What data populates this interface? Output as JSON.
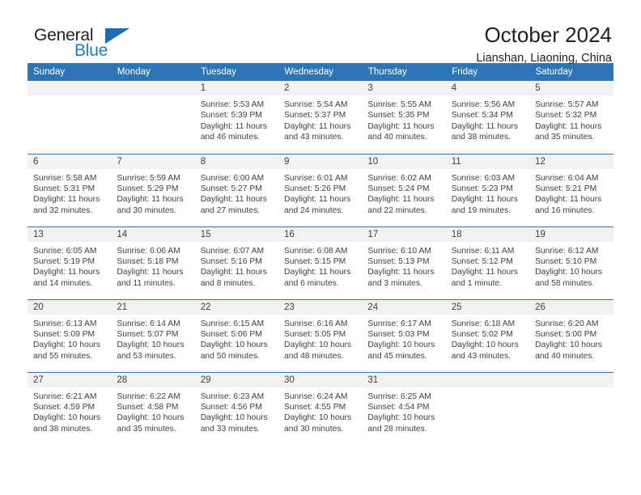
{
  "brand": {
    "name_top": "General",
    "name_bottom": "Blue",
    "color_blue": "#1f7dc4",
    "color_dark": "#231f20"
  },
  "header": {
    "title": "October 2024",
    "location": "Lianshan, Liaoning, China"
  },
  "theme": {
    "header_bg": "#2e75b6",
    "daynum_bg": "#f2f2f2",
    "text": "#3f3f3f"
  },
  "weekdays": [
    "Sunday",
    "Monday",
    "Tuesday",
    "Wednesday",
    "Thursday",
    "Friday",
    "Saturday"
  ],
  "weeks": [
    [
      {
        "day": "",
        "sunrise": "",
        "sunset": "",
        "daylight_l1": "",
        "daylight_l2": "",
        "empty": true
      },
      {
        "day": "",
        "sunrise": "",
        "sunset": "",
        "daylight_l1": "",
        "daylight_l2": "",
        "empty": true
      },
      {
        "day": "1",
        "sunrise": "Sunrise: 5:53 AM",
        "sunset": "Sunset: 5:39 PM",
        "daylight_l1": "Daylight: 11 hours",
        "daylight_l2": "and 46 minutes."
      },
      {
        "day": "2",
        "sunrise": "Sunrise: 5:54 AM",
        "sunset": "Sunset: 5:37 PM",
        "daylight_l1": "Daylight: 11 hours",
        "daylight_l2": "and 43 minutes."
      },
      {
        "day": "3",
        "sunrise": "Sunrise: 5:55 AM",
        "sunset": "Sunset: 5:35 PM",
        "daylight_l1": "Daylight: 11 hours",
        "daylight_l2": "and 40 minutes."
      },
      {
        "day": "4",
        "sunrise": "Sunrise: 5:56 AM",
        "sunset": "Sunset: 5:34 PM",
        "daylight_l1": "Daylight: 11 hours",
        "daylight_l2": "and 38 minutes."
      },
      {
        "day": "5",
        "sunrise": "Sunrise: 5:57 AM",
        "sunset": "Sunset: 5:32 PM",
        "daylight_l1": "Daylight: 11 hours",
        "daylight_l2": "and 35 minutes."
      }
    ],
    [
      {
        "day": "6",
        "sunrise": "Sunrise: 5:58 AM",
        "sunset": "Sunset: 5:31 PM",
        "daylight_l1": "Daylight: 11 hours",
        "daylight_l2": "and 32 minutes."
      },
      {
        "day": "7",
        "sunrise": "Sunrise: 5:59 AM",
        "sunset": "Sunset: 5:29 PM",
        "daylight_l1": "Daylight: 11 hours",
        "daylight_l2": "and 30 minutes."
      },
      {
        "day": "8",
        "sunrise": "Sunrise: 6:00 AM",
        "sunset": "Sunset: 5:27 PM",
        "daylight_l1": "Daylight: 11 hours",
        "daylight_l2": "and 27 minutes."
      },
      {
        "day": "9",
        "sunrise": "Sunrise: 6:01 AM",
        "sunset": "Sunset: 5:26 PM",
        "daylight_l1": "Daylight: 11 hours",
        "daylight_l2": "and 24 minutes."
      },
      {
        "day": "10",
        "sunrise": "Sunrise: 6:02 AM",
        "sunset": "Sunset: 5:24 PM",
        "daylight_l1": "Daylight: 11 hours",
        "daylight_l2": "and 22 minutes."
      },
      {
        "day": "11",
        "sunrise": "Sunrise: 6:03 AM",
        "sunset": "Sunset: 5:23 PM",
        "daylight_l1": "Daylight: 11 hours",
        "daylight_l2": "and 19 minutes."
      },
      {
        "day": "12",
        "sunrise": "Sunrise: 6:04 AM",
        "sunset": "Sunset: 5:21 PM",
        "daylight_l1": "Daylight: 11 hours",
        "daylight_l2": "and 16 minutes."
      }
    ],
    [
      {
        "day": "13",
        "sunrise": "Sunrise: 6:05 AM",
        "sunset": "Sunset: 5:19 PM",
        "daylight_l1": "Daylight: 11 hours",
        "daylight_l2": "and 14 minutes."
      },
      {
        "day": "14",
        "sunrise": "Sunrise: 6:06 AM",
        "sunset": "Sunset: 5:18 PM",
        "daylight_l1": "Daylight: 11 hours",
        "daylight_l2": "and 11 minutes."
      },
      {
        "day": "15",
        "sunrise": "Sunrise: 6:07 AM",
        "sunset": "Sunset: 5:16 PM",
        "daylight_l1": "Daylight: 11 hours",
        "daylight_l2": "and 8 minutes."
      },
      {
        "day": "16",
        "sunrise": "Sunrise: 6:08 AM",
        "sunset": "Sunset: 5:15 PM",
        "daylight_l1": "Daylight: 11 hours",
        "daylight_l2": "and 6 minutes."
      },
      {
        "day": "17",
        "sunrise": "Sunrise: 6:10 AM",
        "sunset": "Sunset: 5:13 PM",
        "daylight_l1": "Daylight: 11 hours",
        "daylight_l2": "and 3 minutes."
      },
      {
        "day": "18",
        "sunrise": "Sunrise: 6:11 AM",
        "sunset": "Sunset: 5:12 PM",
        "daylight_l1": "Daylight: 11 hours",
        "daylight_l2": "and 1 minute."
      },
      {
        "day": "19",
        "sunrise": "Sunrise: 6:12 AM",
        "sunset": "Sunset: 5:10 PM",
        "daylight_l1": "Daylight: 10 hours",
        "daylight_l2": "and 58 minutes."
      }
    ],
    [
      {
        "day": "20",
        "sunrise": "Sunrise: 6:13 AM",
        "sunset": "Sunset: 5:09 PM",
        "daylight_l1": "Daylight: 10 hours",
        "daylight_l2": "and 55 minutes."
      },
      {
        "day": "21",
        "sunrise": "Sunrise: 6:14 AM",
        "sunset": "Sunset: 5:07 PM",
        "daylight_l1": "Daylight: 10 hours",
        "daylight_l2": "and 53 minutes."
      },
      {
        "day": "22",
        "sunrise": "Sunrise: 6:15 AM",
        "sunset": "Sunset: 5:06 PM",
        "daylight_l1": "Daylight: 10 hours",
        "daylight_l2": "and 50 minutes."
      },
      {
        "day": "23",
        "sunrise": "Sunrise: 6:16 AM",
        "sunset": "Sunset: 5:05 PM",
        "daylight_l1": "Daylight: 10 hours",
        "daylight_l2": "and 48 minutes."
      },
      {
        "day": "24",
        "sunrise": "Sunrise: 6:17 AM",
        "sunset": "Sunset: 5:03 PM",
        "daylight_l1": "Daylight: 10 hours",
        "daylight_l2": "and 45 minutes."
      },
      {
        "day": "25",
        "sunrise": "Sunrise: 6:18 AM",
        "sunset": "Sunset: 5:02 PM",
        "daylight_l1": "Daylight: 10 hours",
        "daylight_l2": "and 43 minutes."
      },
      {
        "day": "26",
        "sunrise": "Sunrise: 6:20 AM",
        "sunset": "Sunset: 5:00 PM",
        "daylight_l1": "Daylight: 10 hours",
        "daylight_l2": "and 40 minutes."
      }
    ],
    [
      {
        "day": "27",
        "sunrise": "Sunrise: 6:21 AM",
        "sunset": "Sunset: 4:59 PM",
        "daylight_l1": "Daylight: 10 hours",
        "daylight_l2": "and 38 minutes."
      },
      {
        "day": "28",
        "sunrise": "Sunrise: 6:22 AM",
        "sunset": "Sunset: 4:58 PM",
        "daylight_l1": "Daylight: 10 hours",
        "daylight_l2": "and 35 minutes."
      },
      {
        "day": "29",
        "sunrise": "Sunrise: 6:23 AM",
        "sunset": "Sunset: 4:56 PM",
        "daylight_l1": "Daylight: 10 hours",
        "daylight_l2": "and 33 minutes."
      },
      {
        "day": "30",
        "sunrise": "Sunrise: 6:24 AM",
        "sunset": "Sunset: 4:55 PM",
        "daylight_l1": "Daylight: 10 hours",
        "daylight_l2": "and 30 minutes."
      },
      {
        "day": "31",
        "sunrise": "Sunrise: 6:25 AM",
        "sunset": "Sunset: 4:54 PM",
        "daylight_l1": "Daylight: 10 hours",
        "daylight_l2": "and 28 minutes."
      },
      {
        "day": "",
        "sunrise": "",
        "sunset": "",
        "daylight_l1": "",
        "daylight_l2": "",
        "empty": true
      },
      {
        "day": "",
        "sunrise": "",
        "sunset": "",
        "daylight_l1": "",
        "daylight_l2": "",
        "empty": true
      }
    ]
  ]
}
